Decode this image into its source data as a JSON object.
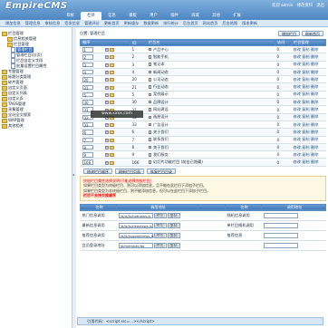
{
  "app": {
    "logo": "EmpireCMS",
    "welcome": "欢迎 admin",
    "toplinks": [
      "修改资料",
      "退出"
    ]
  },
  "top_tabs": [
    {
      "label": "系统",
      "on": false
    },
    {
      "label": "栏目",
      "on": true
    },
    {
      "label": "信息",
      "on": false
    },
    {
      "label": "模板",
      "on": false
    },
    {
      "label": "用户",
      "on": false
    },
    {
      "label": "插件",
      "on": false
    },
    {
      "label": "商城",
      "on": false
    },
    {
      "label": "其他",
      "on": false
    },
    {
      "label": "扩展",
      "on": false
    }
  ],
  "sub_nav": [
    "增加信息",
    "管理信息",
    "审核信息",
    "签发信息",
    "管理评论",
    "更新首页",
    "更新缓存",
    "数据更新",
    "排行统计",
    "后台首页",
    "网站首页",
    "后台地图",
    "版本更新"
  ],
  "tree": [
    {
      "label": "栏目管理",
      "cls": "folder"
    },
    {
      "label": "信息相关管理",
      "cls": "folder c1"
    },
    {
      "label": "栏目管理",
      "cls": "folder c1"
    },
    {
      "label": "管理栏目",
      "cls": "c2",
      "sel": true
    },
    {
      "label": "管理栏目(分页)",
      "cls": "c2"
    },
    {
      "label": "栏目自定义字段",
      "cls": "c2"
    },
    {
      "label": "批量设置栏目属性",
      "cls": "c2"
    },
    {
      "label": "专题管理",
      "cls": "folder"
    },
    {
      "label": "标题分类管理",
      "cls": "folder"
    },
    {
      "label": "碎片管理",
      "cls": "folder"
    },
    {
      "label": "自定义页面",
      "cls": "folder"
    },
    {
      "label": "自定义列表",
      "cls": "folder"
    },
    {
      "label": "自定义JS",
      "cls": "folder"
    },
    {
      "label": "TAGS管理",
      "cls": "folder"
    },
    {
      "label": "采集管理",
      "cls": "folder"
    },
    {
      "label": "全站全文搜索",
      "cls": "folder"
    },
    {
      "label": "WAP管理",
      "cls": "folder"
    },
    {
      "label": "其他相关",
      "cls": "folder"
    }
  ],
  "location": "位置: 管理栏目",
  "top_buttons": [
    "增加栏目",
    "刷新首页"
  ],
  "columns": [
    "顺序",
    "",
    "ID",
    "栏目名",
    "访问",
    "栏目管理"
  ],
  "rows": [
    {
      "order": "1",
      "id": "1",
      "name": "产品中心",
      "visits": "0"
    },
    {
      "order": "2",
      "id": "2",
      "name": "智能手机",
      "visits": "0"
    },
    {
      "order": "3",
      "id": "3",
      "name": "笔记本",
      "visits": "0"
    },
    {
      "order": "4",
      "id": "4",
      "name": "新闻动态",
      "visits": "0"
    },
    {
      "order": "20",
      "id": "20",
      "name": "公司动态",
      "visits": "0"
    },
    {
      "order": "21",
      "id": "21",
      "name": "行业动态",
      "visits": "0"
    },
    {
      "order": "5",
      "id": "5",
      "name": "案例展示",
      "visits": "0"
    },
    {
      "order": "30",
      "id": "30",
      "name": "品牌设计",
      "visits": "0"
    },
    {
      "order": "31",
      "id": "31",
      "name": "网站建设",
      "visits": "0"
    },
    {
      "order": "32",
      "id": "32",
      "name": "画册设计",
      "visits": "0"
    },
    {
      "order": "33",
      "id": "33",
      "name": "广告设计",
      "visits": "0"
    },
    {
      "order": "6",
      "id": "6",
      "name": "关于我们",
      "visits": "0"
    },
    {
      "order": "7",
      "id": "7",
      "name": "联系我们",
      "visits": "0"
    },
    {
      "order": "8",
      "id": "8",
      "name": "关于我们",
      "visits": "0"
    },
    {
      "order": "9",
      "id": "9",
      "name": "我们服务",
      "visits": "0"
    },
    {
      "order": "166",
      "id": "166",
      "name": "幻灯片功能栏目 (前台已隐藏)",
      "visits": "0"
    }
  ],
  "ops_label": "修改 复制 删除",
  "bottom_buttons": [
    "修改栏目顺序",
    "刷新栏目页面",
    "恢复栏目目录"
  ],
  "notes": [
    "终极栏目属性选择说明(只能选择终极栏目)",
    "如果栏目类型为终极栏目，则可以添加信息，且不能在此栏目下添加子栏目。",
    "如果栏目类型为非终极栏目，则不能添加信息，但可以在此栏目下添加子栏目。",
    "栏目不支持交换顺序"
  ],
  "table2": {
    "headers": [
      "名称",
      "调用地址",
      "",
      "名称",
      "调用地址"
    ],
    "rows": [
      {
        "name": "热门信息调用",
        "url": "/d/js/js/hotnews.js",
        "n2": "随机信息调用",
        "u2": ""
      },
      {
        "name": "最新信息调用",
        "url": "/d/js/js/newnews.js",
        "n2": "单栏目随机调用",
        "u2": ""
      },
      {
        "name": "推荐信息调用",
        "url": "/d/js/js/goodnews.js",
        "n2": "推荐信息",
        "u2": ""
      },
      {
        "name": "会员登录地址",
        "url": "/e/member/do",
        "n2": "",
        "u2": ""
      }
    ],
    "preview": "[预览]",
    "copy": "[复制]"
  },
  "footer": "引用代码：<script src=...></script>",
  "watermark": "www.xxxx.com"
}
